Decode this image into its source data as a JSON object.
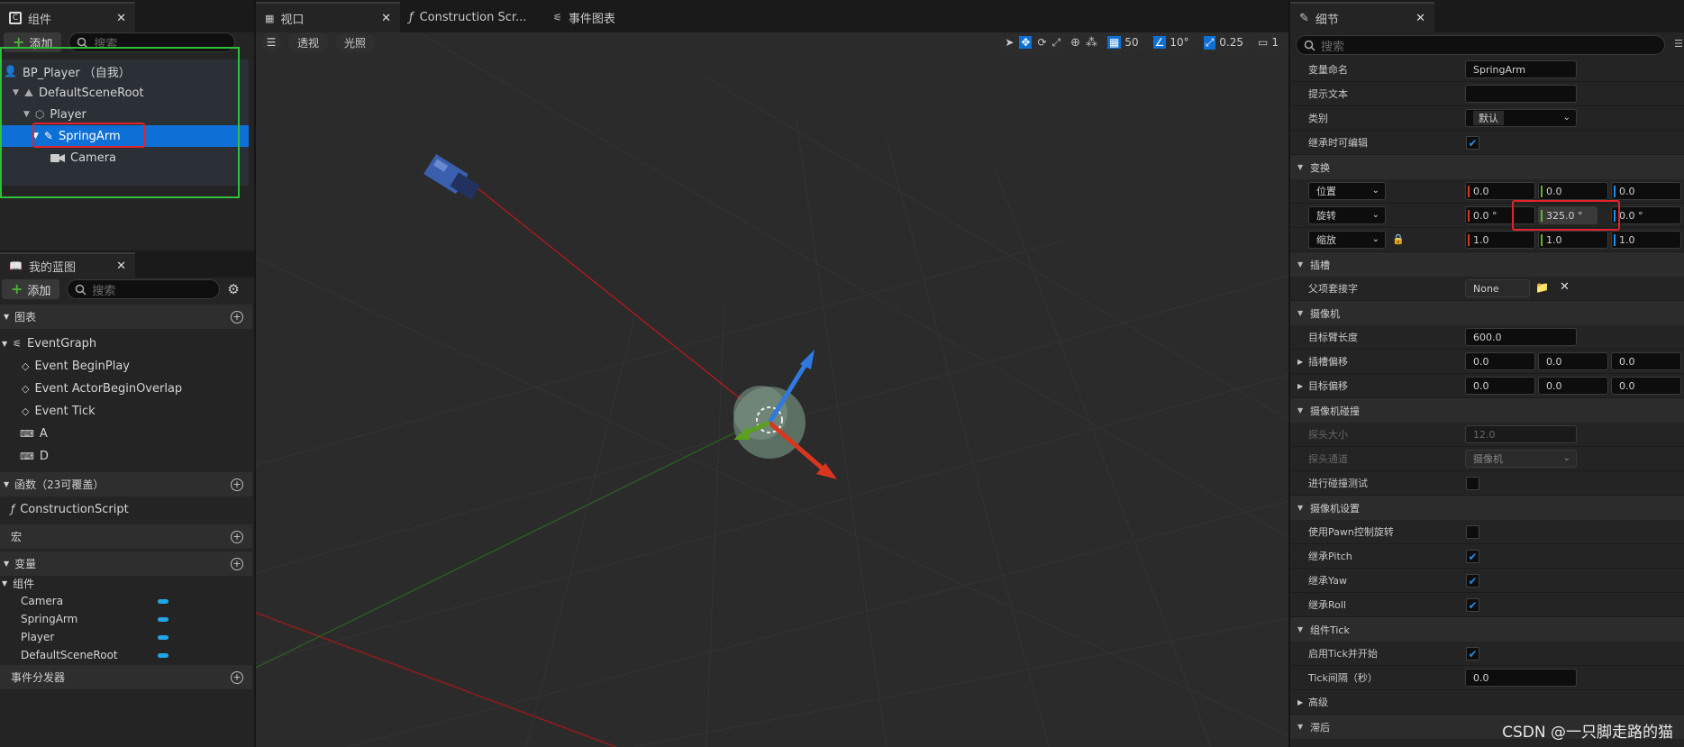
{
  "components_panel": {
    "tab_title": "组件",
    "add_label": "添加",
    "search_placeholder": "搜索",
    "tree": [
      {
        "label": "BP_Player （自我）"
      },
      {
        "label": "DefaultSceneRoot"
      },
      {
        "label": "Player"
      },
      {
        "label": "SpringArm"
      },
      {
        "label": "Camera"
      }
    ]
  },
  "blueprint_panel": {
    "tab_title": "我的蓝图",
    "add_label": "添加",
    "search_placeholder": "搜索",
    "graphs_header": "图表",
    "event_graph": "EventGraph",
    "events": [
      "Event BeginPlay",
      "Event ActorBeginOverlap",
      "Event Tick",
      "A",
      "D"
    ],
    "functions_header": "函数（23可覆盖）",
    "construction_script": "ConstructionScript",
    "macros_header": "宏",
    "variables_header": "变量",
    "components_group": "组件",
    "variables": [
      "Camera",
      "SpringArm",
      "Player",
      "DefaultSceneRoot"
    ],
    "dispatchers_header": "事件分发器"
  },
  "editor_tabs": [
    {
      "label": "视口"
    },
    {
      "label": "Construction Scr..."
    },
    {
      "label": "事件图表"
    }
  ],
  "viewport": {
    "perspective_label": "透视",
    "lighting_label": "光照",
    "grid_snap": "50",
    "rotation_snap": "10°",
    "scale_snap": "0.25",
    "camera_speed": "1"
  },
  "details": {
    "tab_title": "细节",
    "search_placeholder": "搜索",
    "variable_name_label": "变量命名",
    "variable_name_value": "SpringArm",
    "tooltip_label": "提示文本",
    "tooltip_value": "",
    "category_label": "类别",
    "category_value": "默认",
    "editable_label": "继承时可编辑",
    "transform_header": "变换",
    "location_label": "位置",
    "location": [
      "0.0",
      "0.0",
      "0.0"
    ],
    "rotation_label": "旋转",
    "rotation": [
      "0.0 °",
      "325.0 °",
      "0.0 °"
    ],
    "scale_label": "缩放",
    "scale": [
      "1.0",
      "1.0",
      "1.0"
    ],
    "sockets_header": "插槽",
    "parent_socket_label": "父项套接字",
    "parent_socket_value": "None",
    "camera_header": "摄像机",
    "target_arm_label": "目标臂长度",
    "target_arm_value": "600.0",
    "socket_offset_label": "插槽偏移",
    "socket_offset": [
      "0.0",
      "0.0",
      "0.0"
    ],
    "target_offset_label": "目标偏移",
    "target_offset": [
      "0.0",
      "0.0",
      "0.0"
    ],
    "collision_header": "摄像机碰撞",
    "probe_size_label": "探头大小",
    "probe_size_value": "12.0",
    "probe_channel_label": "探头通道",
    "probe_channel_value": "摄像机",
    "do_collision_label": "进行碰撞测试",
    "camera_settings_header": "摄像机设置",
    "use_pawn_label": "使用Pawn控制旋转",
    "inherit_pitch_label": "继承Pitch",
    "inherit_yaw_label": "继承Yaw",
    "inherit_roll_label": "继承Roll",
    "tick_header": "组件Tick",
    "start_tick_label": "启用Tick并开始",
    "tick_interval_label": "Tick间隔（秒）",
    "tick_interval_value": "0.0",
    "advanced_header": "高级",
    "lag_header": "滞后"
  },
  "watermark": "CSDN @一只脚走路的猫",
  "colors": {
    "accent": "#0e70d6",
    "highlight_red": "#e0242b",
    "highlight_green": "#2fbf3a",
    "x_axis": "#e0402a",
    "y_axis": "#6ab022",
    "z_axis": "#1f8ce6"
  }
}
